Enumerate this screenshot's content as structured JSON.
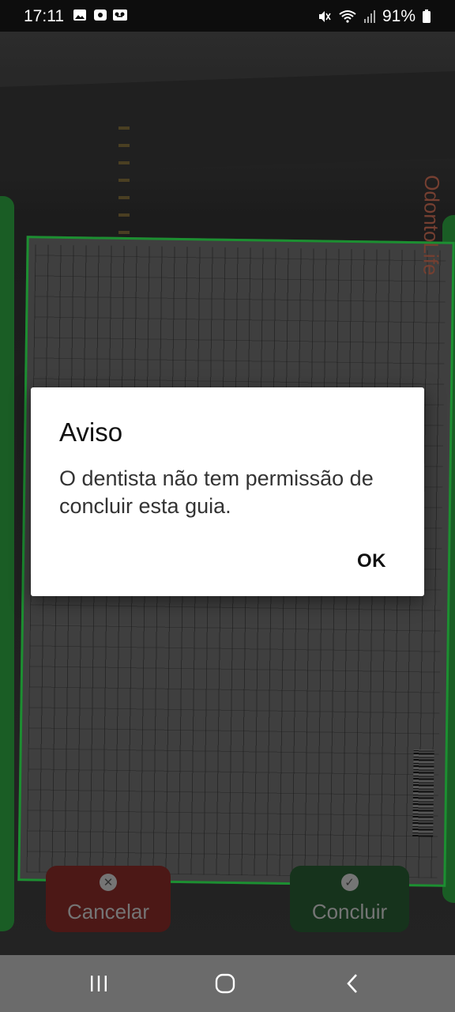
{
  "status_bar": {
    "time": "17:11",
    "battery_percent": "91%"
  },
  "background": {
    "document_brand": "OdontoLife"
  },
  "actions": {
    "cancel_label": "Cancelar",
    "conclude_label": "Concluir"
  },
  "dialog": {
    "title": "Aviso",
    "message": "O dentista não tem permissão de concluir esta guia.",
    "ok_label": "OK"
  },
  "colors": {
    "accent_green": "#22a83a",
    "cancel_red": "#5a1d1b",
    "conclude_green": "#1a3d22"
  }
}
